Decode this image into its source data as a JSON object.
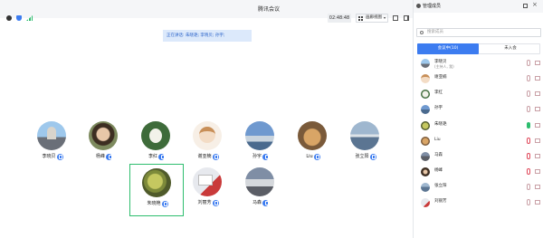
{
  "window": {
    "title": "腾讯会议"
  },
  "toolbar": {
    "timer": "02:48:48",
    "view_label": "画廊视图"
  },
  "speaking_banner": "正在讲话: 朱晓艳; 李晓贝; 孙宇;",
  "tiles": [
    {
      "name": "李晓贝",
      "mic": true
    },
    {
      "name": "杨峰",
      "mic": true
    },
    {
      "name": "李红",
      "mic": true
    },
    {
      "name": "谢亚楠",
      "mic": true
    },
    {
      "name": "孙宇",
      "mic": true
    },
    {
      "name": "Liu",
      "mic": true
    },
    {
      "name": "张立阳",
      "mic": true
    },
    {
      "name": "朱晓艳",
      "mic": true
    },
    {
      "name": "刘丽芳",
      "mic": true
    },
    {
      "name": "马森",
      "mic": true
    }
  ],
  "panel": {
    "title": "管理成员",
    "search_placeholder": "搜索成员",
    "tab_in": "会议中(10)",
    "tab_out": "未入会",
    "members": [
      {
        "name": "李晓贝",
        "sub": "(主持人, 我)"
      },
      {
        "name": "谢亚楠",
        "sub": ""
      },
      {
        "name": "李红",
        "sub": ""
      },
      {
        "name": "孙宇",
        "sub": ""
      },
      {
        "name": "朱晓艳",
        "sub": ""
      },
      {
        "name": "Liu",
        "sub": ""
      },
      {
        "name": "马森",
        "sub": ""
      },
      {
        "name": "杨峰",
        "sub": ""
      },
      {
        "name": "张立阳",
        "sub": ""
      },
      {
        "name": "刘丽芳",
        "sub": ""
      }
    ]
  },
  "colors": {
    "accent": "#3c7cf0",
    "active_border": "#2dbd6e",
    "muted": "#e0485a"
  }
}
